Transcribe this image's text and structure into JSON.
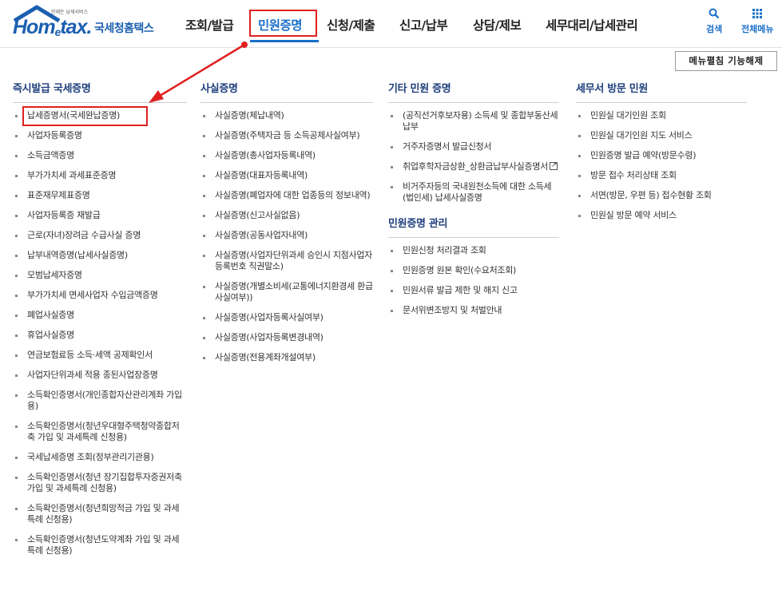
{
  "logo": {
    "tagline": "언제든 납세서비스",
    "word_a": "Hom",
    "word_e": "e",
    "word_b": "tax.",
    "korean_name": "국세청홈택스"
  },
  "gnb": {
    "items": [
      "조회/발급",
      "민원증명",
      "신청/제출",
      "신고/납부",
      "상담/제보",
      "세무대리/납세관리"
    ],
    "active_index": 1
  },
  "util": {
    "search_label": "검색",
    "allmenu_label": "전체메뉴"
  },
  "fold_button": "메뉴펼침 기능해제",
  "columns": {
    "immediate": {
      "title": "즉시발급 국세증명",
      "items": [
        "납세증명서(국세완납증명)",
        "사업자등록증명",
        "소득금액증명",
        "부가가치세 과세표준증명",
        "표준재무제표증명",
        "사업자등록증 재발급",
        "근로(자녀)장려금 수급사실 증명",
        "납부내역증명(납세사실증명)",
        "모범납세자증명",
        "부가가치세 면세사업자 수입금액증명",
        "폐업사실증명",
        "휴업사실증명",
        "연금보험료등 소득·세액 공제확인서",
        "사업자단위과세 적용 종된사업장증명",
        "소득확인증명서(개인종합자산관리계좌 가입용)",
        "소득확인증명서(청년우대형주택청약종합저축 가입 및 과세특례 신청용)",
        "국세납세증명 조회(정부관리기관용)",
        "소득확인증명서(청년 장기집합투자증권저축가입 및 과세특례 신청용)",
        "소득확인증명서(청년희망적금 가입 및 과세특례 신청용)",
        "소득확인증명서(청년도약계좌 가입 및 과세특례 신청용)"
      ]
    },
    "fact": {
      "title": "사실증명",
      "items": [
        "사실증명(체납내역)",
        "사실증명(주택자금 등 소득공제사실여부)",
        "사실증명(총사업자등록내역)",
        "사실증명(대표자등록내역)",
        "사실증명(폐업자에 대한 업종등의 정보내역)",
        "사실증명(신고사실없음)",
        "사실증명(공동사업자내역)",
        "사실증명(사업자단위과세 승인시 지점사업자등록번호 직권말소)",
        "사실증명(개별소비세(교통에너지환경세 환급사실여부))",
        "사실증명(사업자등록사실여부)",
        "사실증명(사업자등록변경내역)",
        "사실증명(전용계좌개설여부)"
      ]
    },
    "other": {
      "title": "기타 민원 증명",
      "items": [
        "(공직선거후보자용) 소득세 및 종합부동산세 납부",
        "거주자증명서 발급신청서",
        "취업후학자금상환_상환금납부사실증명서",
        "비거주자등의 국내원천소득에 대한 소득세(법인세) 납세사실증명"
      ]
    },
    "manage": {
      "title": "민원증명 관리",
      "items": [
        "민원신청 처리결과 조회",
        "민원증명 원본 확인(수요처조회)",
        "민원서류 발급 제한 및 해지 신고",
        "문서위변조방지 및 처벌안내"
      ]
    },
    "visit": {
      "title": "세무서 방문 민원",
      "items": [
        "민원실 대기인원 조회",
        "민원실 대기인원 지도 서비스",
        "민원증명 발급 예약(방문수령)",
        "방문 접수 처리상태 조회",
        "서면(방문, 우편 등) 접수현황 조회",
        "민원실 방문 예약 서비스"
      ]
    }
  },
  "colors": {
    "accent": "#1a6fc9",
    "heading": "#1f3f7c",
    "highlight": "#e02020"
  }
}
